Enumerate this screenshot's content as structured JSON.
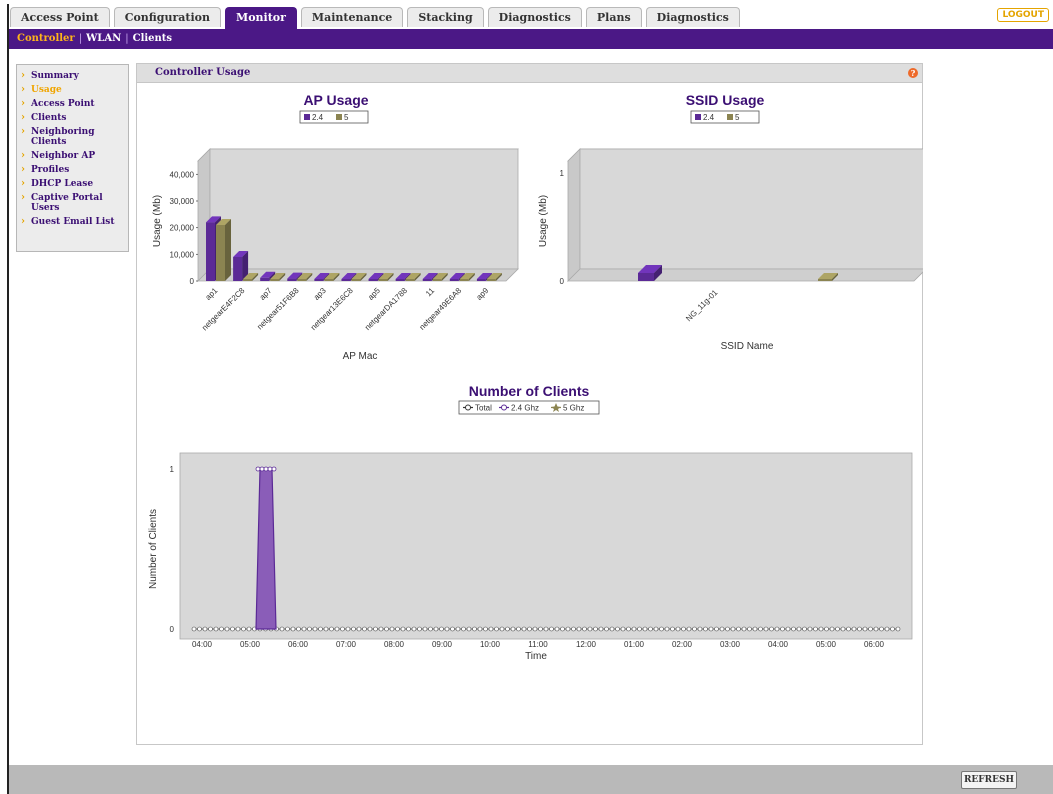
{
  "tabs": [
    {
      "label": "Access Point",
      "active": false
    },
    {
      "label": "Configuration",
      "active": false
    },
    {
      "label": "Monitor",
      "active": true
    },
    {
      "label": "Maintenance",
      "active": false
    },
    {
      "label": "Stacking",
      "active": false
    },
    {
      "label": "Diagnostics",
      "active": false
    },
    {
      "label": "Plans",
      "active": false
    },
    {
      "label": "Diagnostics",
      "active": false
    }
  ],
  "logout_label": "LOGOUT",
  "subnav": [
    {
      "label": "Controller",
      "active": true
    },
    {
      "label": "WLAN",
      "active": false
    },
    {
      "label": "Clients",
      "active": false
    }
  ],
  "sidebar": {
    "items": [
      {
        "label": "Summary",
        "active": false
      },
      {
        "label": "Usage",
        "active": true
      },
      {
        "label": "Access Point",
        "active": false
      },
      {
        "label": "Clients",
        "active": false
      },
      {
        "label": "Neighboring Clients",
        "active": false
      },
      {
        "label": "Neighbor AP",
        "active": false
      },
      {
        "label": "Profiles",
        "active": false
      },
      {
        "label": "DHCP Lease",
        "active": false
      },
      {
        "label": "Captive Portal Users",
        "active": false
      },
      {
        "label": "Guest Email List",
        "active": false
      }
    ]
  },
  "panel": {
    "title": "Controller Usage",
    "help_icon": "help-icon"
  },
  "refresh_label": "REFRESH",
  "colors": {
    "brand": "#4b1886",
    "accent": "#f0a500",
    "series_24": "#5b2a96",
    "series_5": "#8b8451"
  },
  "chart_data": [
    {
      "type": "bar",
      "title": "AP Usage",
      "xlabel": "AP Mac",
      "ylabel": "Usage (Mb)",
      "ylim": [
        0,
        45000
      ],
      "yticks": [
        "0",
        "10,000",
        "20,000",
        "30,000",
        "40,000"
      ],
      "categories": [
        "ap1",
        "netgearE4F2C8",
        "ap7",
        "netgear51F6B8",
        "ap3",
        "netgear13E6C8",
        "ap5",
        "netgearDA1788",
        "11",
        "netgear49E6A8",
        "ap9"
      ],
      "series": [
        {
          "name": "2.4",
          "values": [
            22000,
            9000,
            1200,
            900,
            700,
            500,
            700,
            500,
            500,
            500,
            500
          ]
        },
        {
          "name": "5",
          "values": [
            21000,
            600,
            300,
            300,
            300,
            300,
            300,
            300,
            300,
            300,
            300
          ]
        }
      ]
    },
    {
      "type": "bar",
      "title": "SSID Usage",
      "xlabel": "SSID Name",
      "ylabel": "Usage (Mb)",
      "ylim": [
        0,
        1
      ],
      "yticks": [
        "0",
        "1"
      ],
      "categories": [
        "NG_11g-01"
      ],
      "series": [
        {
          "name": "2.4",
          "values": [
            0.05
          ]
        },
        {
          "name": "5",
          "values": [
            0.02
          ]
        }
      ]
    },
    {
      "type": "area",
      "title": "Number of Clients",
      "xlabel": "Time",
      "ylabel": "Number of Clients",
      "ylim": [
        0,
        1
      ],
      "yticks": [
        "0",
        "1"
      ],
      "x": [
        "04:00",
        "05:00",
        "06:00",
        "07:00",
        "08:00",
        "09:00",
        "10:00",
        "11:00",
        "12:00",
        "01:00",
        "02:00",
        "03:00",
        "04:00",
        "05:00",
        "06:00"
      ],
      "series": [
        {
          "name": "Total",
          "peak_x": "05:00",
          "peak_value": 1
        },
        {
          "name": "2.4 Ghz",
          "peak_x": "05:00",
          "peak_value": 1
        },
        {
          "name": "5 Ghz",
          "peak_x": "05:00",
          "peak_value": 0
        }
      ]
    }
  ]
}
